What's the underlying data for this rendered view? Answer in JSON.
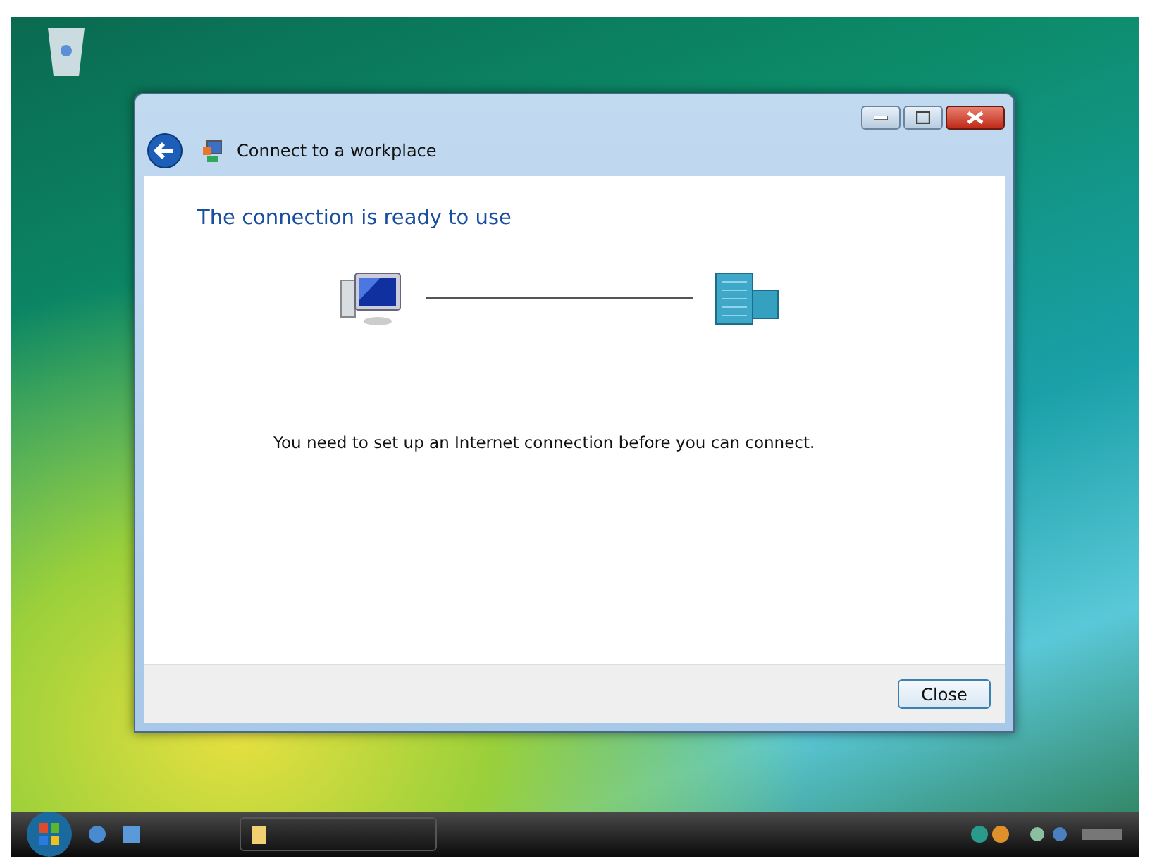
{
  "window": {
    "title": "Connect to a workplace"
  },
  "heading": "The connection is ready to use",
  "message": "You need to set up an Internet connection before you can connect.",
  "buttons": [
    "Close"
  ]
}
